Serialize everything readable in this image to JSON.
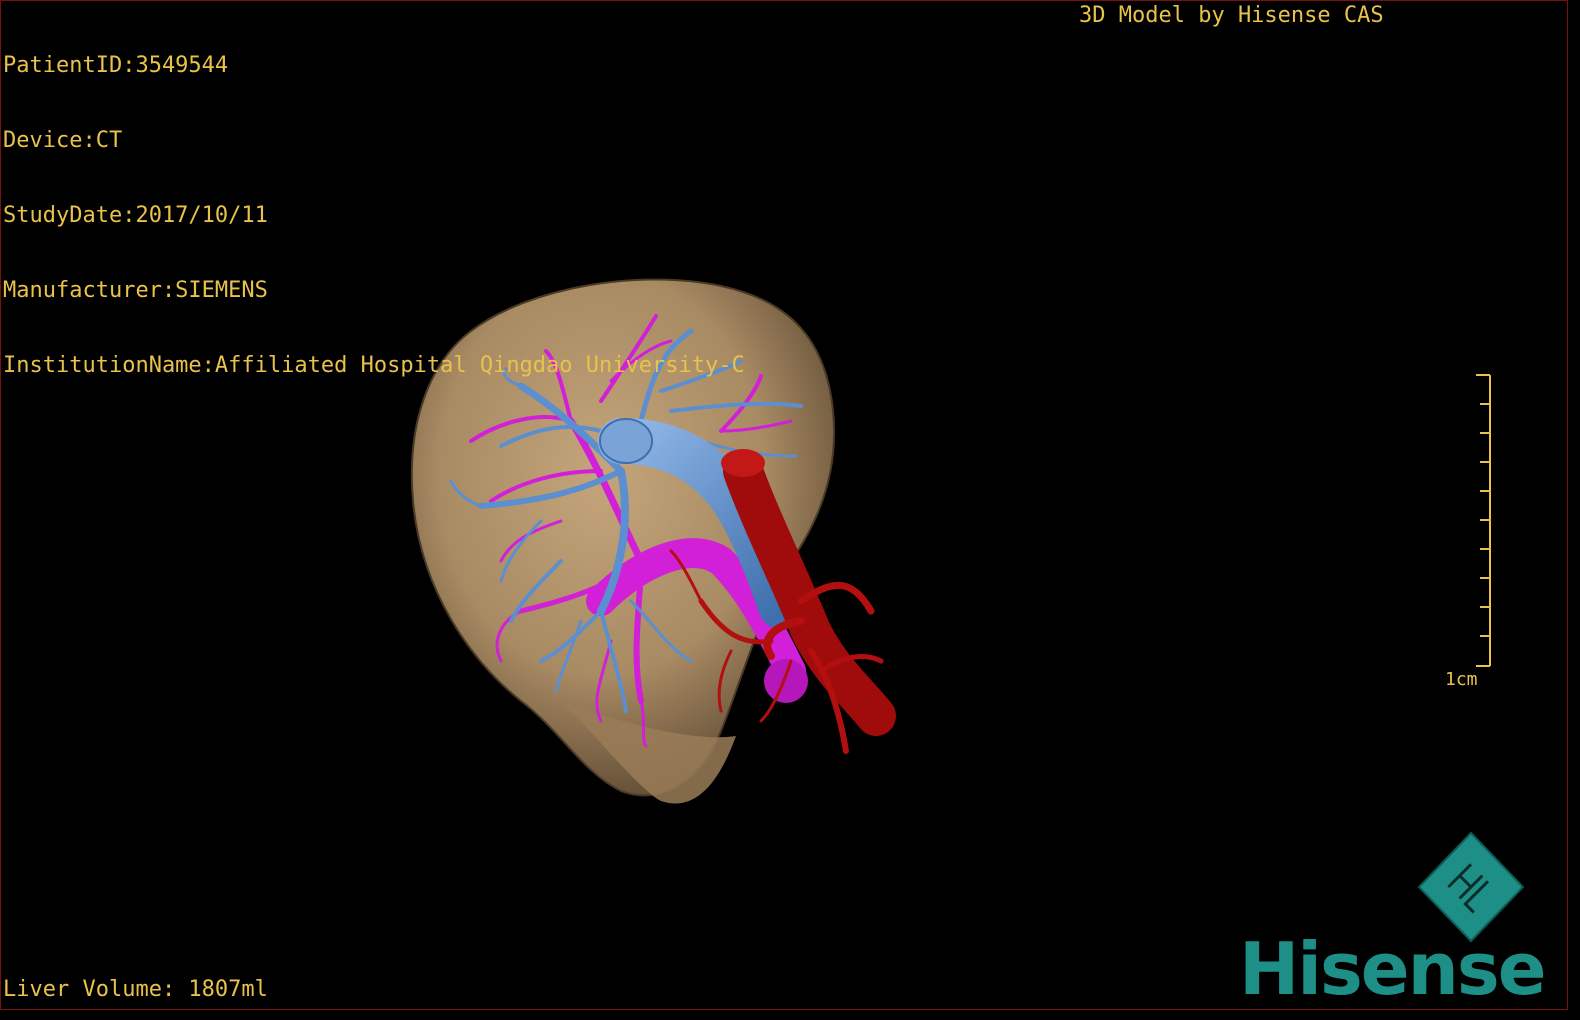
{
  "header": {
    "patient_id": "PatientID:3549544",
    "device": "Device:CT",
    "study_date": "StudyDate:2017/10/11",
    "manufacturer": "Manufacturer:SIEMENS",
    "institution": "InstitutionName:Affiliated Hospital Qingdao University-C"
  },
  "credit": "3D Model by Hisense CAS",
  "footer": {
    "liver_volume": "Liver Volume: 1807ml"
  },
  "scale_bar": {
    "label": "1cm"
  },
  "logo": {
    "brand": "Hisense",
    "emblem_letters": "HL"
  },
  "colors": {
    "overlay_text": "#e8c24a",
    "liver": "#a88a63",
    "portal_vein": "#5b8fcf",
    "hepatic_vein": "#d21fd8",
    "artery": "#a00c0c",
    "brand": "#1d8f86"
  }
}
